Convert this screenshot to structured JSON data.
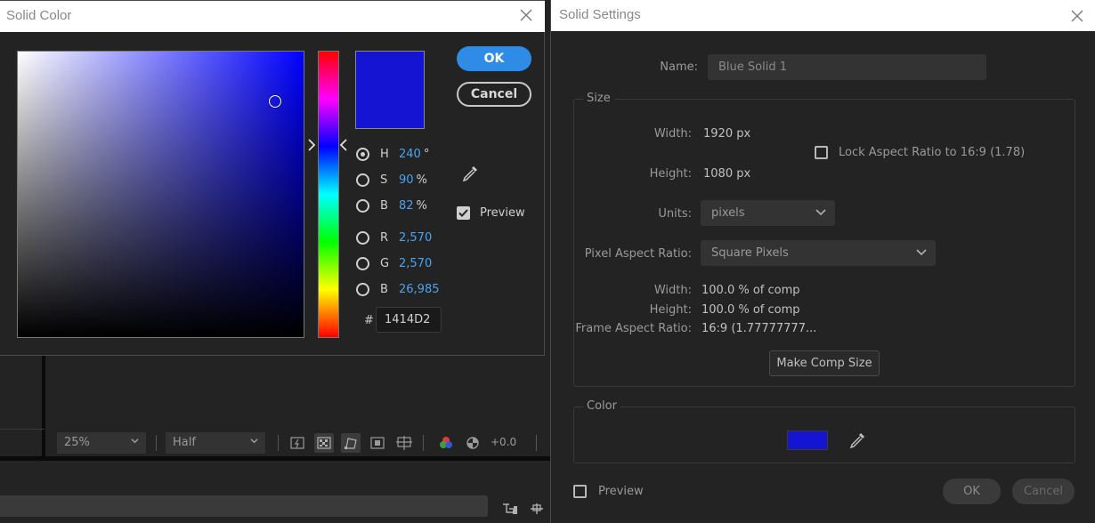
{
  "solid_color": {
    "title": "Solid Color",
    "ok_label": "OK",
    "cancel_label": "Cancel",
    "preview_label": "Preview",
    "preview_checked": true,
    "current_color": "#1414D2",
    "modes": [
      {
        "label": "H",
        "value": "240",
        "unit": "°",
        "selected": true
      },
      {
        "label": "S",
        "value": "90",
        "unit": "%",
        "selected": false
      },
      {
        "label": "B",
        "value": "82",
        "unit": "%",
        "selected": false
      },
      {
        "label": "R",
        "value": "2,570",
        "unit": "",
        "selected": false
      },
      {
        "label": "G",
        "value": "2,570",
        "unit": "",
        "selected": false
      },
      {
        "label": "B",
        "value": "26,985",
        "unit": "",
        "selected": false
      }
    ],
    "hex_label": "#",
    "hex_value": "1414D2"
  },
  "viewer": {
    "zoom": "25%",
    "resolution": "Half",
    "exposure": "+0.0"
  },
  "solid_settings": {
    "title": "Solid Settings",
    "name_label": "Name:",
    "name_value": "Blue Solid 1",
    "size_legend": "Size",
    "width_label": "Width:",
    "width_value": "1920 px",
    "height_label": "Height:",
    "height_value": "1080 px",
    "lock_label": "Lock Aspect Ratio to 16:9 (1.78)",
    "lock_checked": false,
    "units_label": "Units:",
    "units_value": "pixels",
    "par_label": "Pixel Aspect Ratio:",
    "par_value": "Square Pixels",
    "pct_width_label": "Width:",
    "pct_width_value": "100.0 % of comp",
    "pct_height_label": "Height:",
    "pct_height_value": "100.0 % of comp",
    "far_label": "Frame Aspect Ratio:",
    "far_value": "16:9 (1.77777777...",
    "make_comp_label": "Make Comp Size",
    "color_legend": "Color",
    "color_value": "#1414D2",
    "preview_label": "Preview",
    "preview_checked": false,
    "ok_label": "OK",
    "cancel_label": "Cancel"
  }
}
